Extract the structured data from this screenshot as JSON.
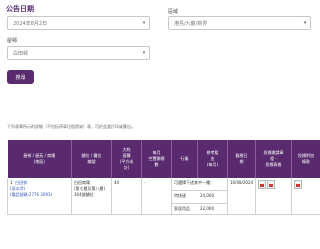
{
  "form": {
    "title": "公告日期",
    "date_value": "2024年8月2日",
    "district_label": "區域",
    "district_value": "港島/九龍/新界",
    "estate_label": "屋邨",
    "estate_value": "白田邨",
    "search_label": "搜尋"
  },
  "results": {
    "note": "下列表單所示的詳細（不包括停車位租賃或）表，可於此處打印或匯出。",
    "columns": [
      "屋邨 / 屋苑 / 商場\n(地區)",
      "舖位 / 攤位\n編號",
      "大約\n面積\n(平方米\n計)",
      "每月\n空置開標\n數",
      "行業",
      "參考租\n金\n(每月)",
      "截標日\n期",
      "投標邀請章\n程 -\n投標表格",
      "投標附加\n條款"
    ],
    "rows": [
      {
        "index": "1",
        "estate": "白田邨",
        "estate_sub": "(深水埗)",
        "estate_tel": "(電話號碼:2776 3093)",
        "shop": "白田商場\n(第七層及第八層)\n304號舖位",
        "area": "44",
        "vacancy": "-",
        "trade_main": "可選擇下述其中一種：",
        "trade_sub1": "特快速",
        "trade_sub2": "家居用品",
        "rent1": "24,000",
        "rent2": "22,000",
        "closing_date": "16/08/2024"
      }
    ]
  },
  "icons": {
    "chevron": "chevron-down-icon",
    "pdf": "pdf-icon"
  },
  "colors": {
    "brand": "#5a2a6e",
    "link": "#3355bb"
  }
}
